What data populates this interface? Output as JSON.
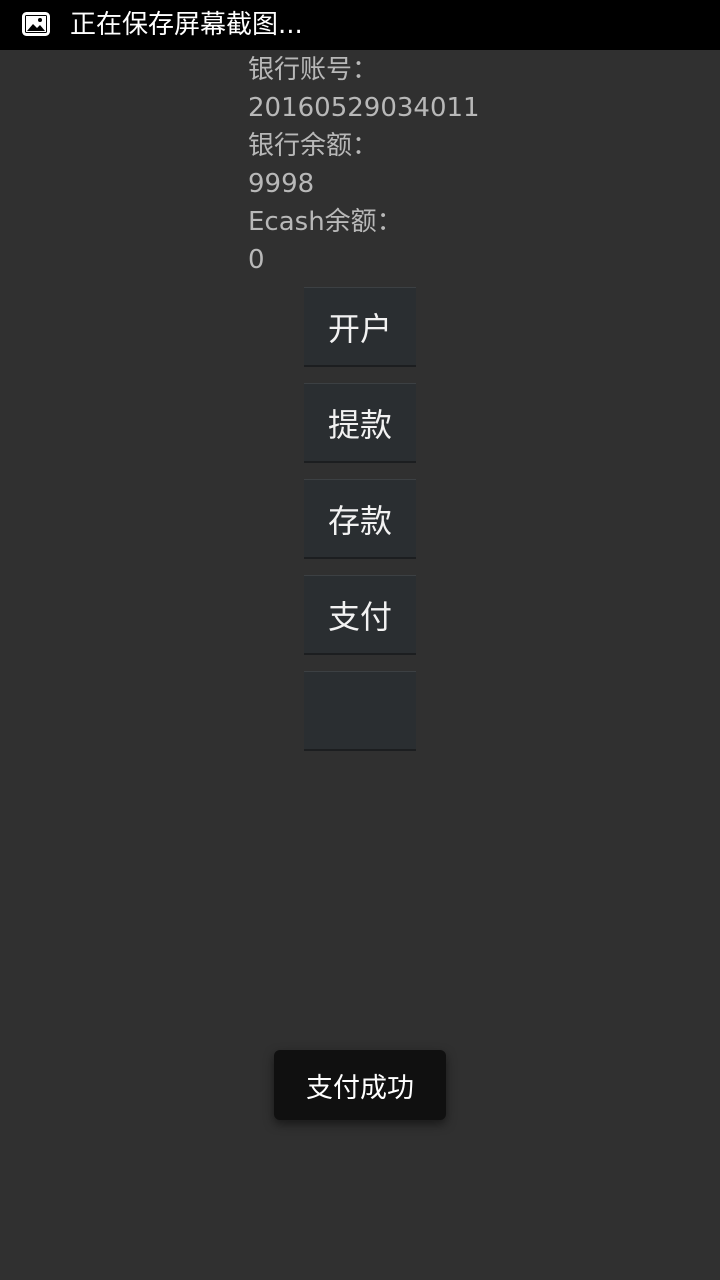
{
  "status_bar": {
    "icon": "image-icon",
    "text": "正在保存屏幕截图..."
  },
  "account": {
    "bank_account_label": "银行账号：",
    "bank_account_value": "20160529034011",
    "bank_balance_label": "银行余额：",
    "bank_balance_value": "9998",
    "ecash_balance_label": "Ecash余额：",
    "ecash_balance_value": "0"
  },
  "buttons": {
    "open_account": "开户",
    "withdraw": "提款",
    "deposit": "存款",
    "pay": "支付",
    "blank": ""
  },
  "toast": {
    "text": "支付成功"
  }
}
